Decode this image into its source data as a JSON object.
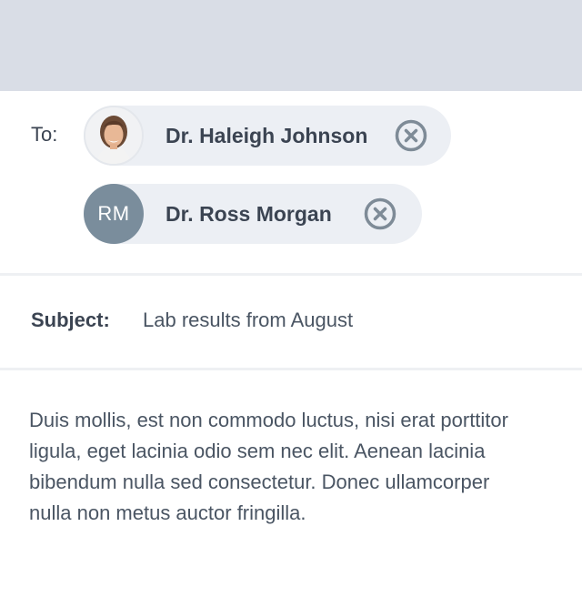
{
  "compose": {
    "to_label": "To:",
    "recipients": [
      {
        "name": "Dr. Haleigh Johnson",
        "avatar_type": "photo",
        "remove_icon": "close-circle-icon"
      },
      {
        "name": "Dr. Ross Morgan",
        "avatar_type": "initials",
        "initials": "RM",
        "avatar_color": "#7a8d9c",
        "remove_icon": "close-circle-icon"
      }
    ],
    "subject_label": "Subject:",
    "subject_value": "Lab results from August",
    "body": "Duis mollis, est non commodo luctus, nisi erat porttitor ligula, eget lacinia odio sem nec elit. Aenean lacinia bibendum nulla sed consectetur. Donec ullamcorper nulla non metus auctor fringilla."
  },
  "colors": {
    "header_background": "#d9dde6",
    "chip_background": "#eceff4",
    "remove_icon": "#7e8b97",
    "text": "#3b4452"
  }
}
